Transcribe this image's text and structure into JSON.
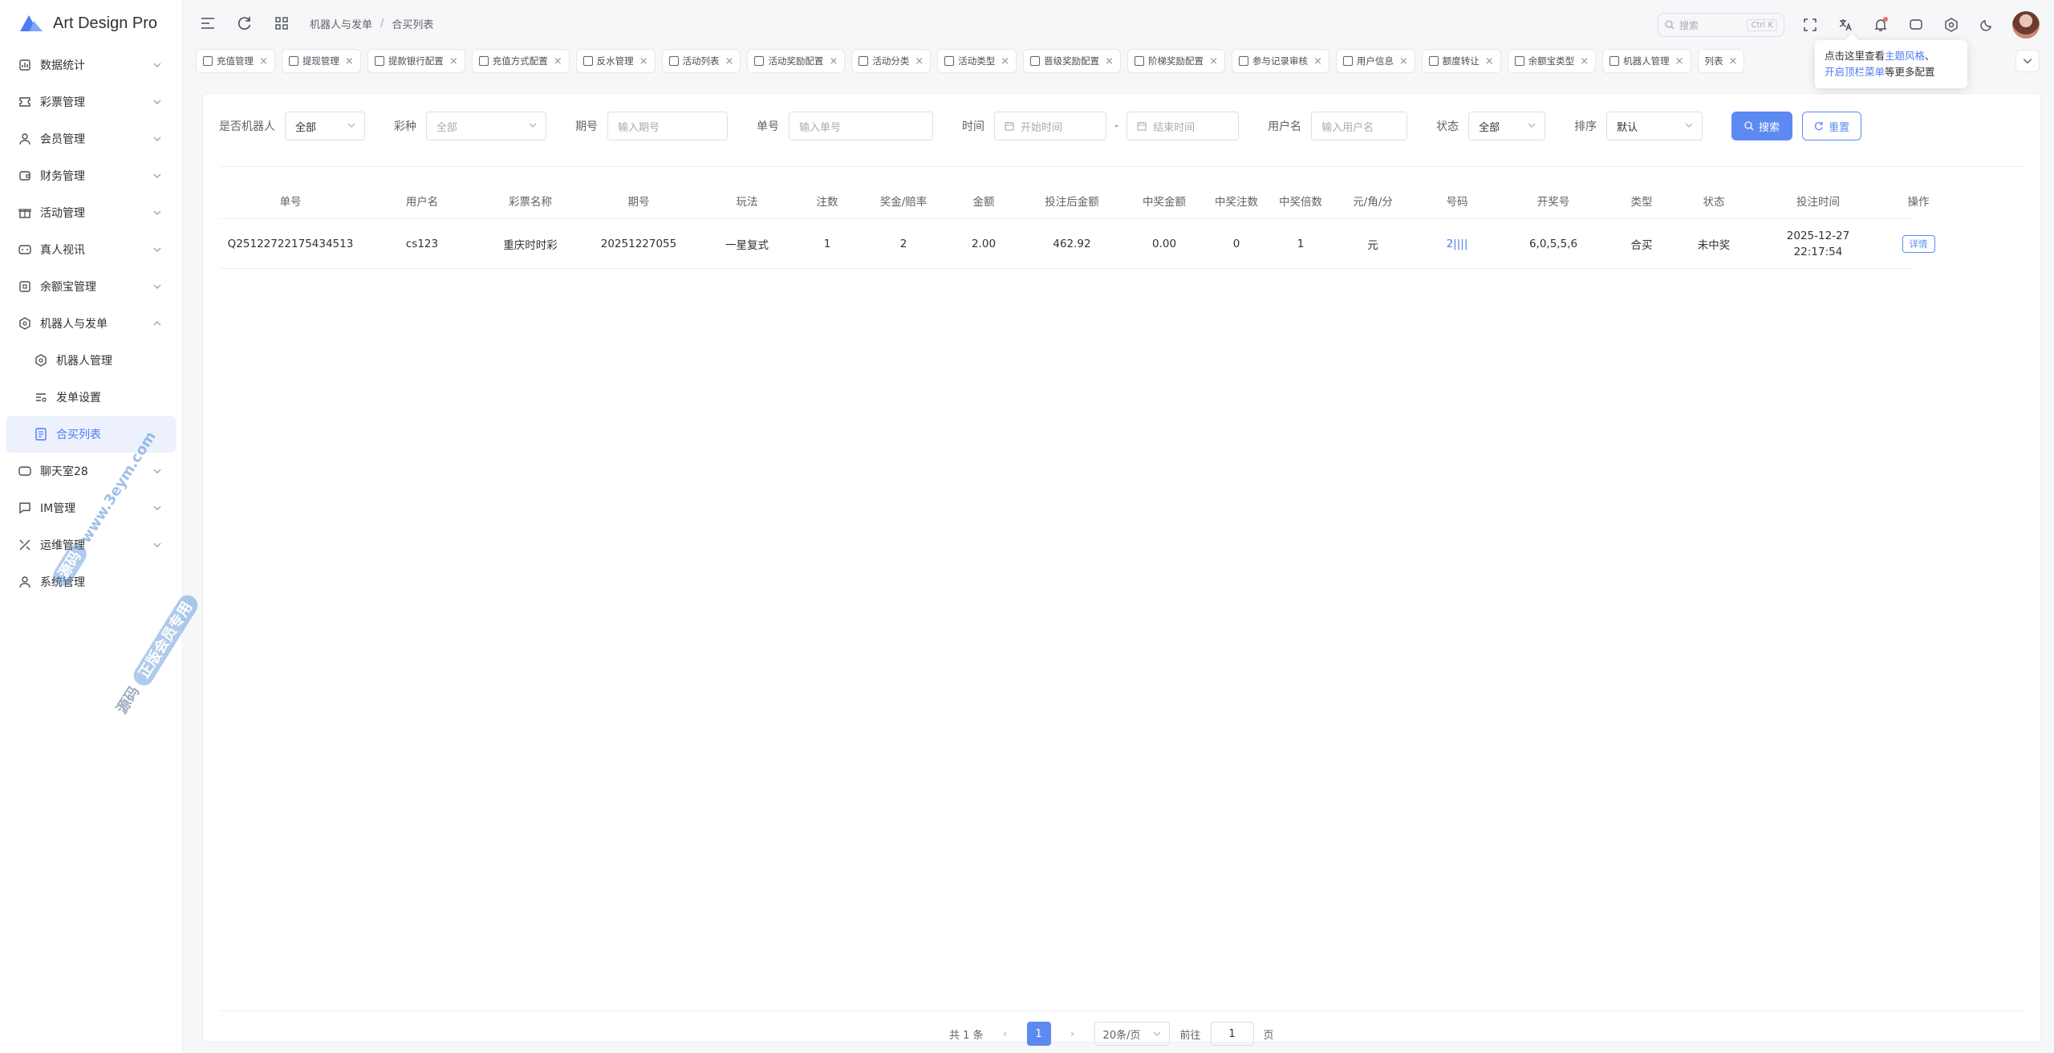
{
  "app": {
    "title": "Art Design Pro",
    "brand_color": "#4d7cf3"
  },
  "sidebar": {
    "items": [
      {
        "label": "数据统计",
        "icon": "chart-icon"
      },
      {
        "label": "彩票管理",
        "icon": "ticket-icon"
      },
      {
        "label": "会员管理",
        "icon": "user-icon"
      },
      {
        "label": "财务管理",
        "icon": "wallet-icon"
      },
      {
        "label": "活动管理",
        "icon": "gift-icon"
      },
      {
        "label": "真人视讯",
        "icon": "video-icon"
      },
      {
        "label": "余额宝管理",
        "icon": "safe-icon"
      },
      {
        "label": "机器人与发单",
        "icon": "robot-icon"
      },
      {
        "label": "机器人管理",
        "icon": "hex-icon"
      },
      {
        "label": "发单设置",
        "icon": "filter-icon"
      },
      {
        "label": "合买列表",
        "icon": "list-icon"
      },
      {
        "label": "聊天室28",
        "icon": "chat-icon"
      },
      {
        "label": "IM管理",
        "icon": "message-icon"
      },
      {
        "label": "运维管理",
        "icon": "tools-icon"
      },
      {
        "label": "系统管理",
        "icon": "user-icon"
      }
    ]
  },
  "header": {
    "breadcrumb": [
      "机器人与发单",
      "合买列表"
    ],
    "search_placeholder": "搜索",
    "search_kbd": "Ctrl K"
  },
  "tabs": [
    "充值管理",
    "提现管理",
    "提款银行配置",
    "充值方式配置",
    "反水管理",
    "活动列表",
    "活动奖励配置",
    "活动分类",
    "活动类型",
    "晋级奖励配置",
    "阶梯奖励配置",
    "参与记录审核",
    "用户信息",
    "额度转让",
    "余额宝类型",
    "机器人管理",
    "列表"
  ],
  "tooltip": {
    "line1a": "点击这里查看",
    "line1b": "主题风格",
    "line1c": "、",
    "line2a": "开启顶栏菜单",
    "line2b": "等更多配置"
  },
  "filters": {
    "is_robot_label": "是否机器人",
    "is_robot_value": "全部",
    "lottery_label": "彩种",
    "lottery_placeholder": "全部",
    "issue_label": "期号",
    "issue_placeholder": "输入期号",
    "order_label": "单号",
    "order_placeholder": "输入单号",
    "time_label": "时间",
    "start_placeholder": "开始时间",
    "dash": "-",
    "end_placeholder": "结束时间",
    "user_label": "用户名",
    "user_placeholder": "输入用户名",
    "status_label": "状态",
    "status_value": "全部",
    "sort_label": "排序",
    "sort_value": "默认",
    "search_btn": "搜索",
    "reset_btn": "重置"
  },
  "table": {
    "headers": [
      "单号",
      "用户名",
      "彩票名称",
      "期号",
      "玩法",
      "注数",
      "奖金/赔率",
      "金额",
      "投注后金额",
      "中奖金额",
      "中奖注数",
      "中奖倍数",
      "元/角/分",
      "号码",
      "开奖号",
      "类型",
      "状态",
      "投注时间",
      "操作"
    ],
    "rows": [
      {
        "id": "Q25122722175434513",
        "user": "cs123",
        "lottery": "重庆时时彩",
        "issue": "20251227055",
        "play": "一星复式",
        "notes": "1",
        "rate": "2",
        "amount": "2.00",
        "after": "462.92",
        "win_amount": "0.00",
        "win_notes": "0",
        "win_mult": "1",
        "unit": "元",
        "numbers": "2||||",
        "open": "6,0,5,5,6",
        "type": "合买",
        "status": "未中奖",
        "date": "2025-12-27",
        "time": "22:17:54",
        "op": "详情"
      }
    ]
  },
  "pagination": {
    "total": "共 1 条",
    "page": "1",
    "size": "20条/页",
    "goto": "前往",
    "goto_value": "1",
    "page_unit": "页"
  },
  "watermark": {
    "a": "源码",
    "b": "www.3eym.com",
    "c": "源码",
    "d": "正版会员专用"
  }
}
